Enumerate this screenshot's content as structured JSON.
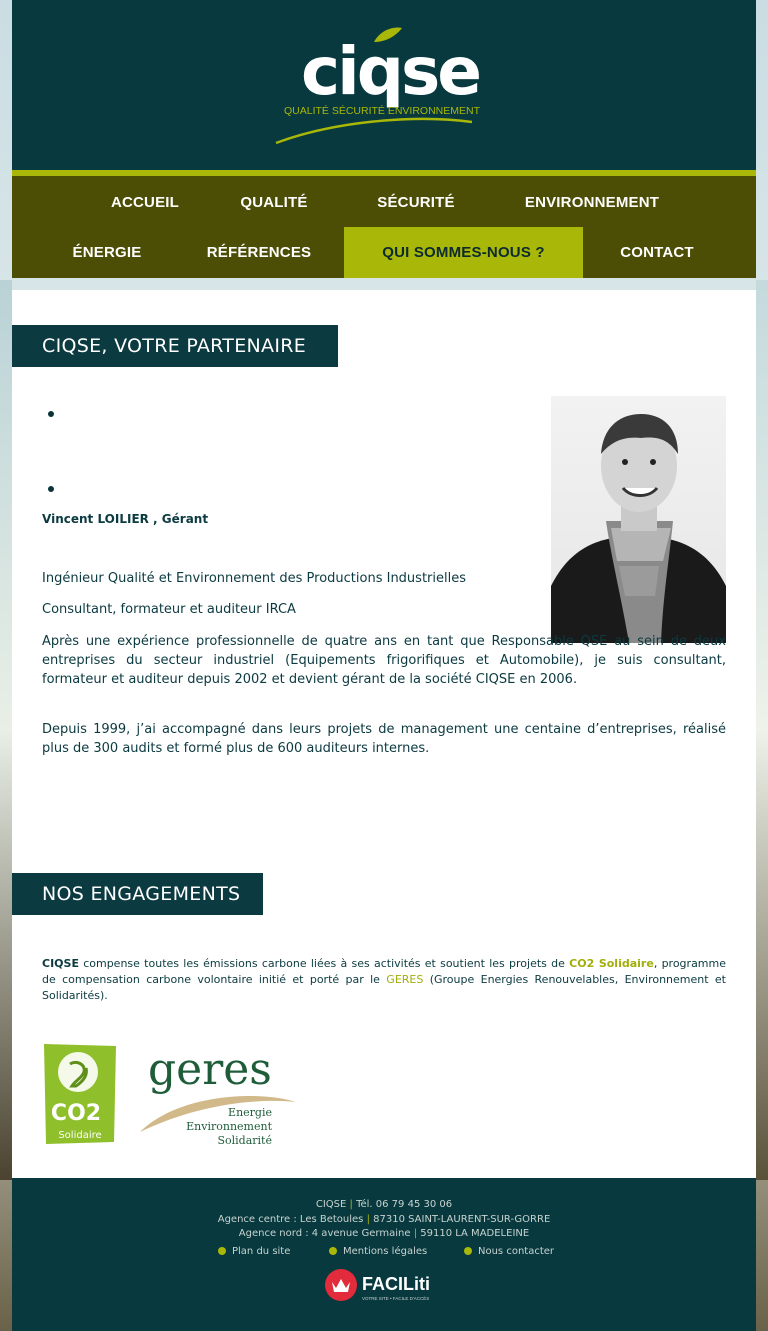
{
  "brand": {
    "logo_text": "ciqse",
    "tagline": "QUALITÉ SÉCURITÉ ENVIRONNEMENT"
  },
  "nav": {
    "items": [
      {
        "label": "ACCUEIL"
      },
      {
        "label": "QUALITÉ"
      },
      {
        "label": "SÉCURITÉ"
      },
      {
        "label": "ENVIRONNEMENT"
      },
      {
        "label": "ÉNERGIE"
      },
      {
        "label": "RÉFÉRENCES"
      },
      {
        "label": "QUI SOMMES-NOUS ?"
      },
      {
        "label": "CONTACT"
      }
    ],
    "active": "QUI SOMMES-NOUS ?"
  },
  "partner": {
    "title": "CIQSE, VOTRE PARTENAIRE",
    "name": "Vincent LOILIER , Gérant",
    "role1": "Ingénieur Qualité et Environnement des Productions Industrielles",
    "role2": "Consultant, formateur et auditeur IRCA",
    "para1": "Après une expérience professionnelle de quatre ans en tant que Responsable QSE au sein de deux entreprises du secteur industriel (Equipements frigorifiques et Automobile), je suis consultant, formateur et auditeur depuis 2002 et devient gérant de la société CIQSE en 2006.",
    "para2": "Depuis 1999, j’ai accompagné dans leurs projets de management une centaine d’entreprises, réalisé plus de 300 audits et formé plus de 600 auditeurs internes."
  },
  "engagements": {
    "title": "NOS ENGAGEMENTS",
    "brand": "CIQSE",
    "text1": " compense toutes les émissions carbone liées à ses activités et soutient les projets de ",
    "co2_link": "CO2 Solidaire",
    "text2": ", programme de compensation carbone volontaire initié et porté par le ",
    "geres_link": "GERES",
    "text3": " (Groupe Energies Renouvelables, Environnement et Solidarités).",
    "co2_logo": {
      "line1": "CO2",
      "line2": "Solidaire"
    },
    "geres_logo": {
      "name": "geres",
      "line1": "Energie",
      "line2": "Environnement",
      "line3": "Solidarité"
    }
  },
  "footer": {
    "company": "CIQSE",
    "phone": "Tél. 06 79 45 30 06",
    "agency_centre": "Agence centre : Les Betoules",
    "agency_centre_city": "87310 SAINT-LAURENT-SUR-GORRE",
    "agency_nord": "Agence nord : 4 avenue Germaine",
    "agency_nord_city": "59110 LA MADELEINE",
    "links": [
      "Plan du site",
      "Mentions légales",
      "Nous contacter"
    ],
    "faciliti": {
      "name": "FACILiti",
      "tagline": "VOTRE SITE • FACILE D'ACCÈS"
    }
  },
  "colors": {
    "dark_teal": "#07393f",
    "olive": "#4d4e06",
    "accent": "#a9b708"
  }
}
